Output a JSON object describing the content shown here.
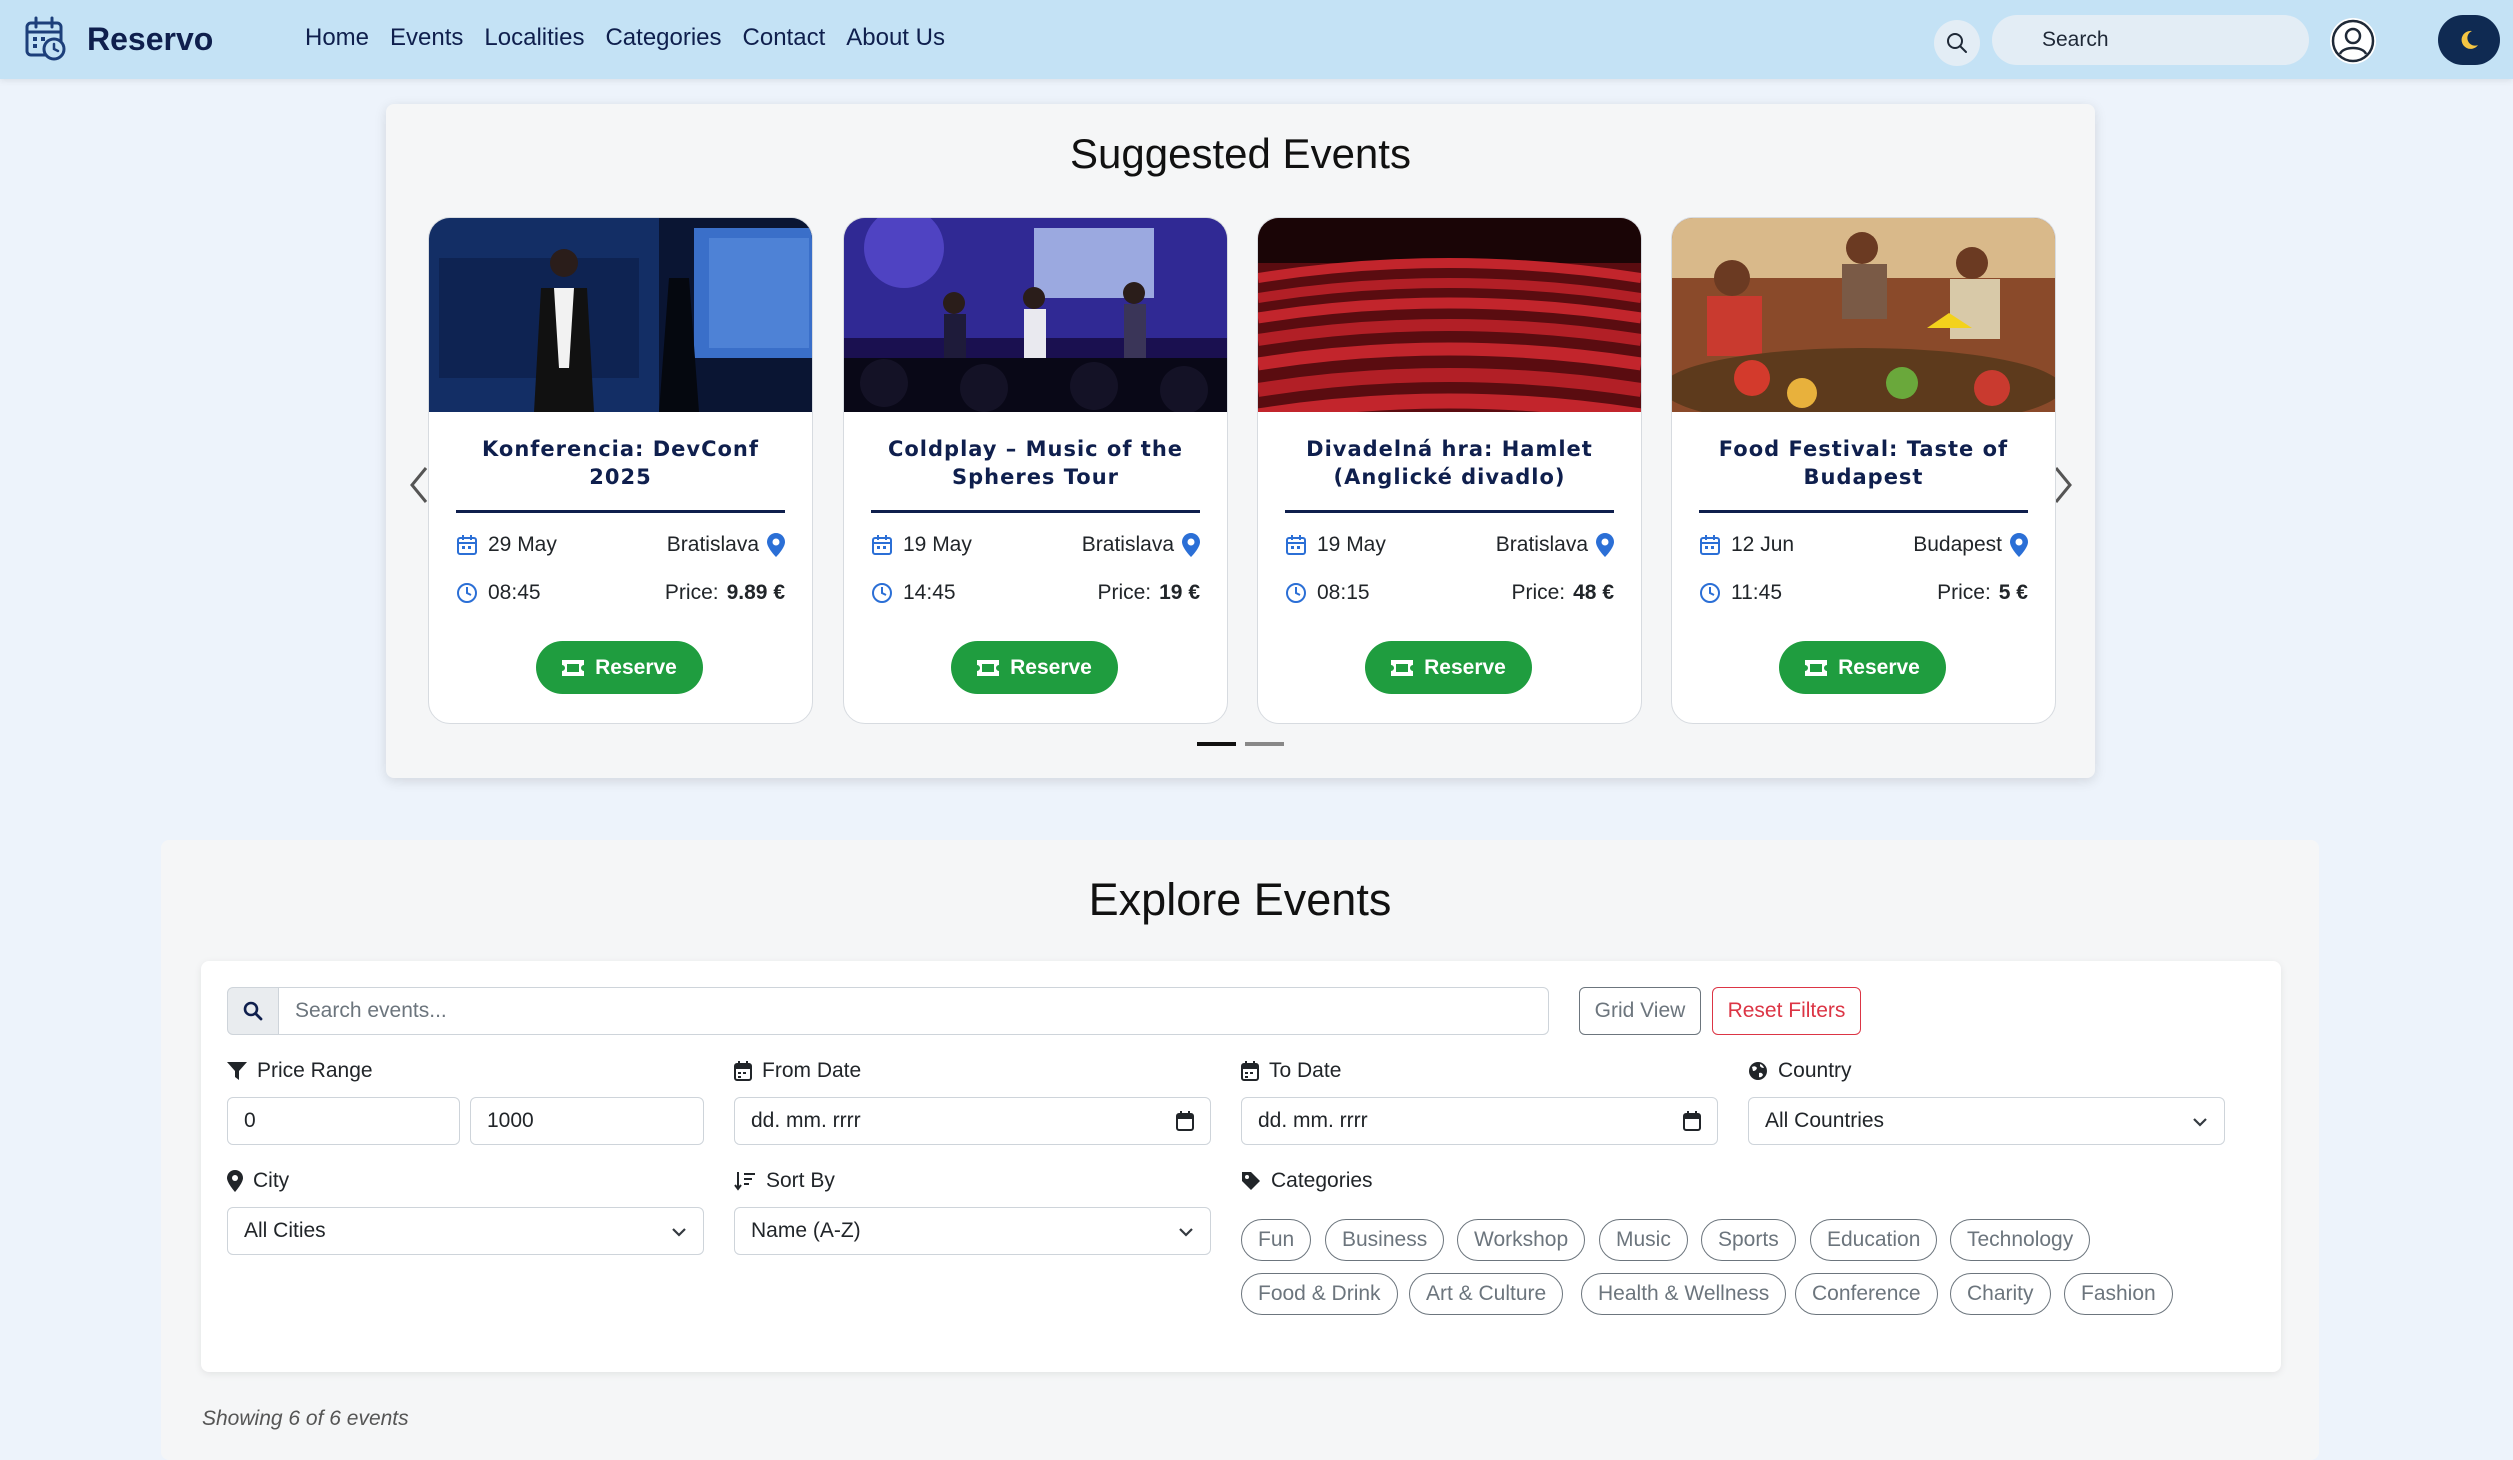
{
  "navbar": {
    "brand": "Reservo",
    "links": [
      "Home",
      "Events",
      "Localities",
      "Categories",
      "Contact",
      "About Us"
    ],
    "search_placeholder": "Search"
  },
  "suggested": {
    "title": "Suggested Events",
    "reserve_label": "Reserve",
    "price_label": "Price:",
    "events": [
      {
        "title": "Konferencia: DevConf 2025",
        "date": "29 May",
        "city": "Bratislava",
        "time": "08:45",
        "price": "9.89 €",
        "image": "conference-speaker-photo"
      },
      {
        "title": "Coldplay – Music of the Spheres Tour",
        "date": "19 May",
        "city": "Bratislava",
        "time": "14:45",
        "price": "19 €",
        "image": "concert-stage-photo"
      },
      {
        "title": "Divadelná hra: Hamlet (Anglické divadlo)",
        "date": "19 May",
        "city": "Bratislava",
        "time": "08:15",
        "price": "48 €",
        "image": "theatre-seats-photo"
      },
      {
        "title": "Food Festival: Taste of Budapest",
        "date": "12 Jun",
        "city": "Budapest",
        "time": "11:45",
        "price": "5 €",
        "image": "food-market-photo"
      }
    ]
  },
  "explore": {
    "title": "Explore Events",
    "search_placeholder": "Search events...",
    "grid_view_label": "Grid View",
    "reset_label": "Reset Filters",
    "price_range": {
      "label": "Price Range",
      "min": "0",
      "max": "1000"
    },
    "from_date": {
      "label": "From Date",
      "value": "dd. mm. rrrr"
    },
    "to_date": {
      "label": "To Date",
      "value": "dd. mm. rrrr"
    },
    "country": {
      "label": "Country",
      "selected": "All Countries"
    },
    "city": {
      "label": "City",
      "selected": "All Cities"
    },
    "sort_by": {
      "label": "Sort By",
      "selected": "Name (A-Z)"
    },
    "categories": {
      "label": "Categories",
      "items": [
        "Fun",
        "Business",
        "Workshop",
        "Music",
        "Sports",
        "Education",
        "Technology",
        "Food & Drink",
        "Art & Culture",
        "Health & Wellness",
        "Conference",
        "Charity",
        "Fashion"
      ]
    },
    "showing_text": "Showing 6 of 6 events"
  },
  "colors": {
    "navbar_bg": "#c4e2f5",
    "brand_navy": "#0f1f4d",
    "reserve_green": "#1f9d3f",
    "icon_blue": "#2b6fd6",
    "danger_red": "#dc3545"
  }
}
